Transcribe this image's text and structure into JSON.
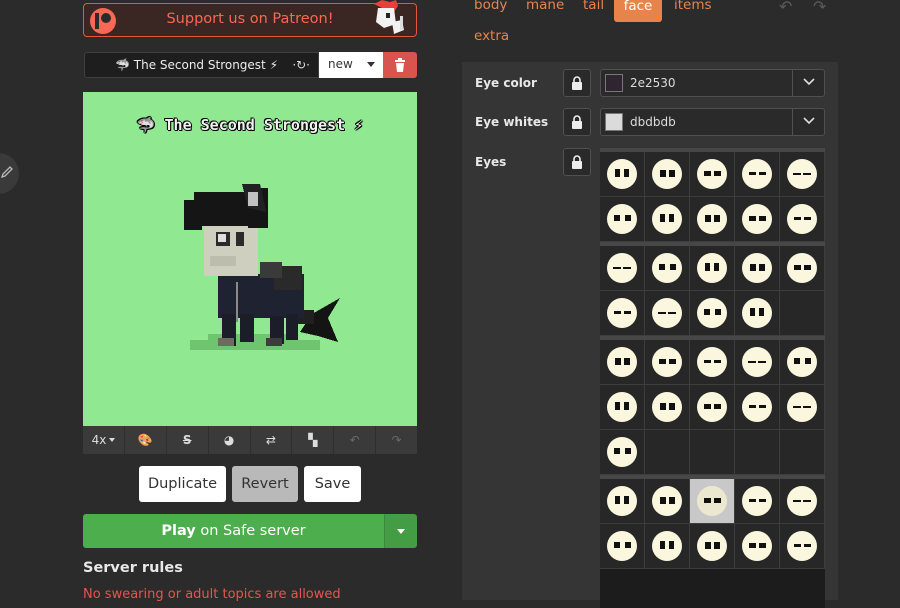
{
  "left": {
    "patreon_label": "Support us on Patreon!",
    "character_name": "🦈 The Second Strongest ⚡",
    "new_option": "new",
    "preview_name": "🦈 The Second Strongest ⚡",
    "toolbar": {
      "zoom": "4x"
    },
    "buttons": {
      "duplicate": "Duplicate",
      "revert": "Revert",
      "save": "Save"
    },
    "play": {
      "bold": "Play",
      "rest": " on Safe server"
    },
    "rules_title": "Server rules",
    "rule_1": "No swearing or adult topics are allowed"
  },
  "tabs": [
    "body",
    "mane",
    "tail",
    "face",
    "items",
    "extra"
  ],
  "active_tab": "face",
  "face": {
    "eye_color_label": "Eye color",
    "eye_color_value": "2e2530",
    "eye_whites_label": "Eye whites",
    "eye_whites_value": "dbdbdb",
    "eyes_label": "Eyes"
  },
  "colors": {
    "accent": "#e8844a",
    "play": "#4cae4c",
    "danger": "#d9534f",
    "preview_bg": "#90e890",
    "eye_color": "#2e2530",
    "eye_whites": "#dbdbdb"
  },
  "eye_groups": [
    10,
    9,
    11,
    10
  ],
  "selected_eye": {
    "group": 3,
    "index": 2
  }
}
